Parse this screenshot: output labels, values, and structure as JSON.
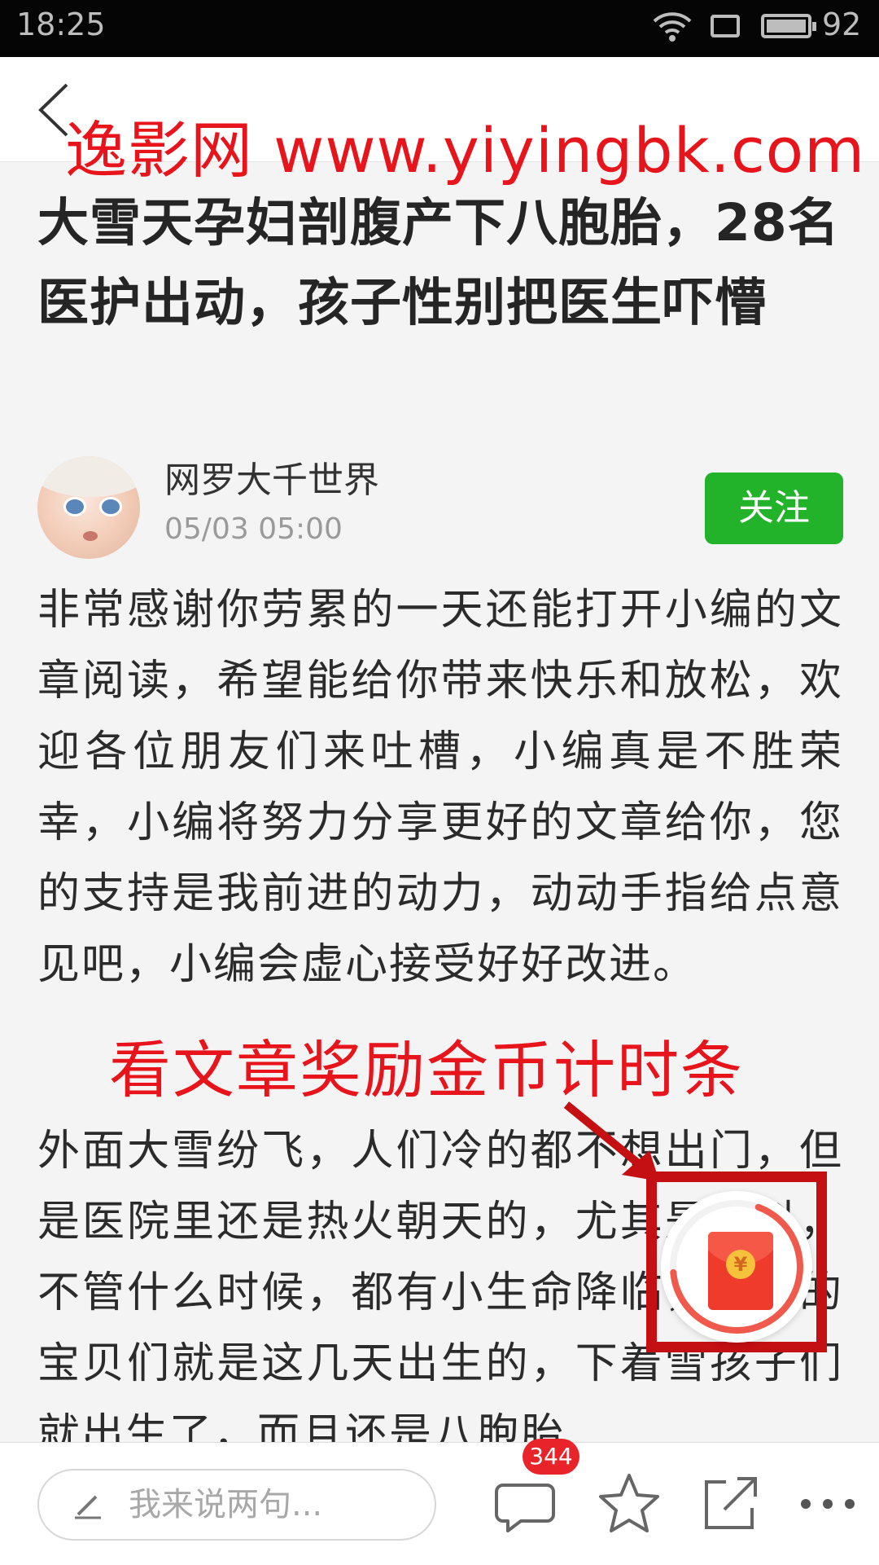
{
  "status_bar": {
    "time": "18:25",
    "battery": "92"
  },
  "watermarks": {
    "top": "逸影网 www.yiyingbk.com",
    "middle": "看文章奖励金币计时条"
  },
  "article": {
    "title": "大雪天孕妇剖腹产下八胞胎，28名医护出动，孩子性别把医生吓懵",
    "author": {
      "name": "网罗大千世界",
      "date": "05/03 05:00"
    },
    "follow_label": "关注",
    "paragraphs": [
      "非常感谢你劳累的一天还能打开小编的文章阅读，希望能给你带来快乐和放松，欢迎各位朋友们来吐槽，小编真是不胜荣幸，小编将努力分享更好的文章给你，您的支持是我前进的动力，动动手指给点意见吧，小编会虚心接受好好改进。",
      "外面大雪纷飞，人们冷的都不想出门，但是医院里还是热火朝天的，尤其是产科，不管什么时候，都有小生命降临，小兰的宝贝们就是这几天出生的，下着雪孩子们就出生了，而且还是八胞胎"
    ]
  },
  "reward_timer": {
    "progress": 0.68,
    "coin_symbol": "¥"
  },
  "bottom_bar": {
    "comment_placeholder": "我来说两句...",
    "comment_count": "344"
  },
  "colors": {
    "watermark_red": "#e8141c",
    "follow_green": "#22b32a",
    "timer_red": "#f05a4c",
    "highlight_red": "#c40f13",
    "badge_red": "#e8232a"
  },
  "icons": [
    "back-arrow-icon",
    "wifi-icon",
    "sim-icon",
    "battery-icon",
    "pen-icon",
    "comment-icon",
    "star-icon",
    "share-icon",
    "more-icon",
    "red-envelope-icon"
  ]
}
